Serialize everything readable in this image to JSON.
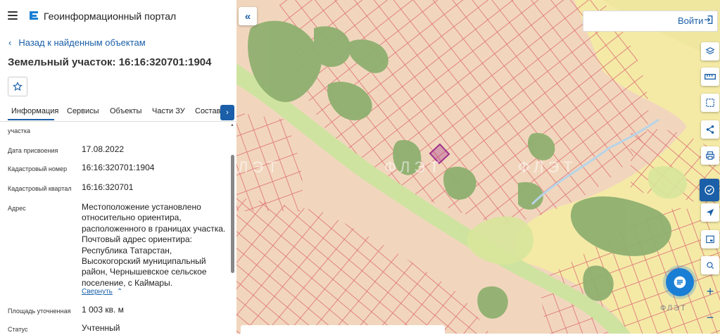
{
  "header": {
    "portal_title": "Геоинформационный портал",
    "menu_icon": "hamburger-icon",
    "logo_icon": "portal-logo-icon"
  },
  "nav": {
    "back_label": "Назад к найденным объектам"
  },
  "parcel": {
    "title": "Земельный участок: 16:16:320701:1904"
  },
  "tabs": [
    {
      "label": "Информация",
      "active": true
    },
    {
      "label": "Сервисы"
    },
    {
      "label": "Объекты"
    },
    {
      "label": "Части ЗУ"
    },
    {
      "label": "Состав"
    }
  ],
  "info_rows": [
    {
      "label": "участка",
      "value": ""
    },
    {
      "label": "Дата присвоения",
      "value": "17.08.2022"
    },
    {
      "label": "Кадастровый номер",
      "value": "16:16:320701:1904"
    },
    {
      "label": "Кадастровый квартал",
      "value": "16:16:320701"
    },
    {
      "label": "Адрес",
      "value": "Местоположение установлено относительно ориентира, расположенного в границах участка. Почтовый адрес ориентира: Республика Татарстан, Высокогорский муниципальный район, Чернышевское сельское поселение, с Каймары."
    },
    {
      "label": "Площадь уточненная",
      "value": "1 003 кв. м"
    },
    {
      "label": "Статус",
      "value": "Учтенный"
    }
  ],
  "address_collapse_label": "Свернуть",
  "map": {
    "login_label": "Войти",
    "watermark": "ФЛЭТ",
    "colors": {
      "background": "#f1d6bd",
      "parcel_line": "#e07a7a",
      "forest": "#8fb070",
      "field": "#e6f0a8",
      "selected": "#a0308a",
      "road": "#f4e9a0"
    },
    "tools": [
      "layers-icon",
      "ruler-icon",
      "select-area-icon",
      "share-icon",
      "print-icon",
      "chat-icon",
      "locate-icon",
      "card-icon",
      "search-area-icon",
      "zoom-in-icon",
      "zoom-out-icon"
    ]
  }
}
